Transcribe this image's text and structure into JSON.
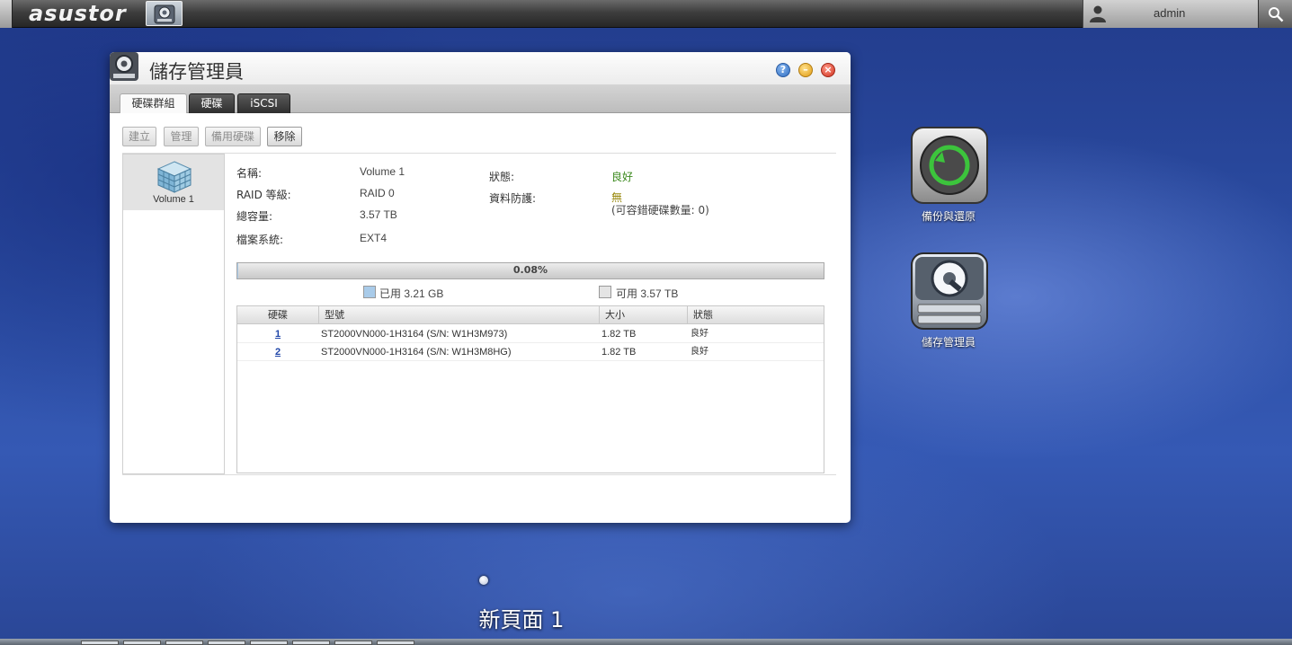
{
  "topbar": {
    "brand": "asustor",
    "user": "admin"
  },
  "window": {
    "title": "儲存管理員",
    "controls": {
      "help": "?",
      "minimize": "–",
      "close": "×"
    },
    "tabs": [
      {
        "label": "硬碟群組",
        "active": true
      },
      {
        "label": "硬碟",
        "active": false
      },
      {
        "label": "iSCSI",
        "active": false
      }
    ],
    "toolbar": {
      "create": "建立",
      "manage": "管理",
      "spare": "備用硬碟",
      "remove": "移除"
    },
    "volume_list": [
      {
        "label": "Volume 1"
      }
    ],
    "details": {
      "name_label": "名稱:",
      "name_value": "Volume 1",
      "raid_label": "RAID 等級:",
      "raid_value": "RAID 0",
      "capacity_label": "總容量:",
      "capacity_value": "3.57 TB",
      "fs_label": "檔案系統:",
      "fs_value": "EXT4",
      "status_label": "狀態:",
      "status_value": "良好",
      "protection_label": "資料防護:",
      "protection_value": "無",
      "protection_note": "(可容錯硬碟數量: 0)"
    },
    "usage": {
      "percent_text": "0.08%",
      "used_fraction": 0.0008,
      "used_label": "已用 3.21 GB",
      "free_label": "可用 3.57 TB",
      "used_color": "#a9cbe9",
      "free_color": "#e4e4e4"
    },
    "disk_table": {
      "headers": {
        "disk": "硬碟",
        "model": "型號",
        "size": "大小",
        "status": "狀態"
      },
      "rows": [
        {
          "disk": "1",
          "model": "ST2000VN000-1H3164 (S/N: W1H3M973)",
          "size": "1.82 TB",
          "status": "良好"
        },
        {
          "disk": "2",
          "model": "ST2000VN000-1H3164 (S/N: W1H3M8HG)",
          "size": "1.82 TB",
          "status": "良好"
        }
      ]
    }
  },
  "desktop": {
    "icons": [
      {
        "label": "備份與還原",
        "icon": "backup-restore-icon"
      },
      {
        "label": "儲存管理員",
        "icon": "storage-manager-icon"
      }
    ],
    "page_label": "新頁面 1"
  }
}
